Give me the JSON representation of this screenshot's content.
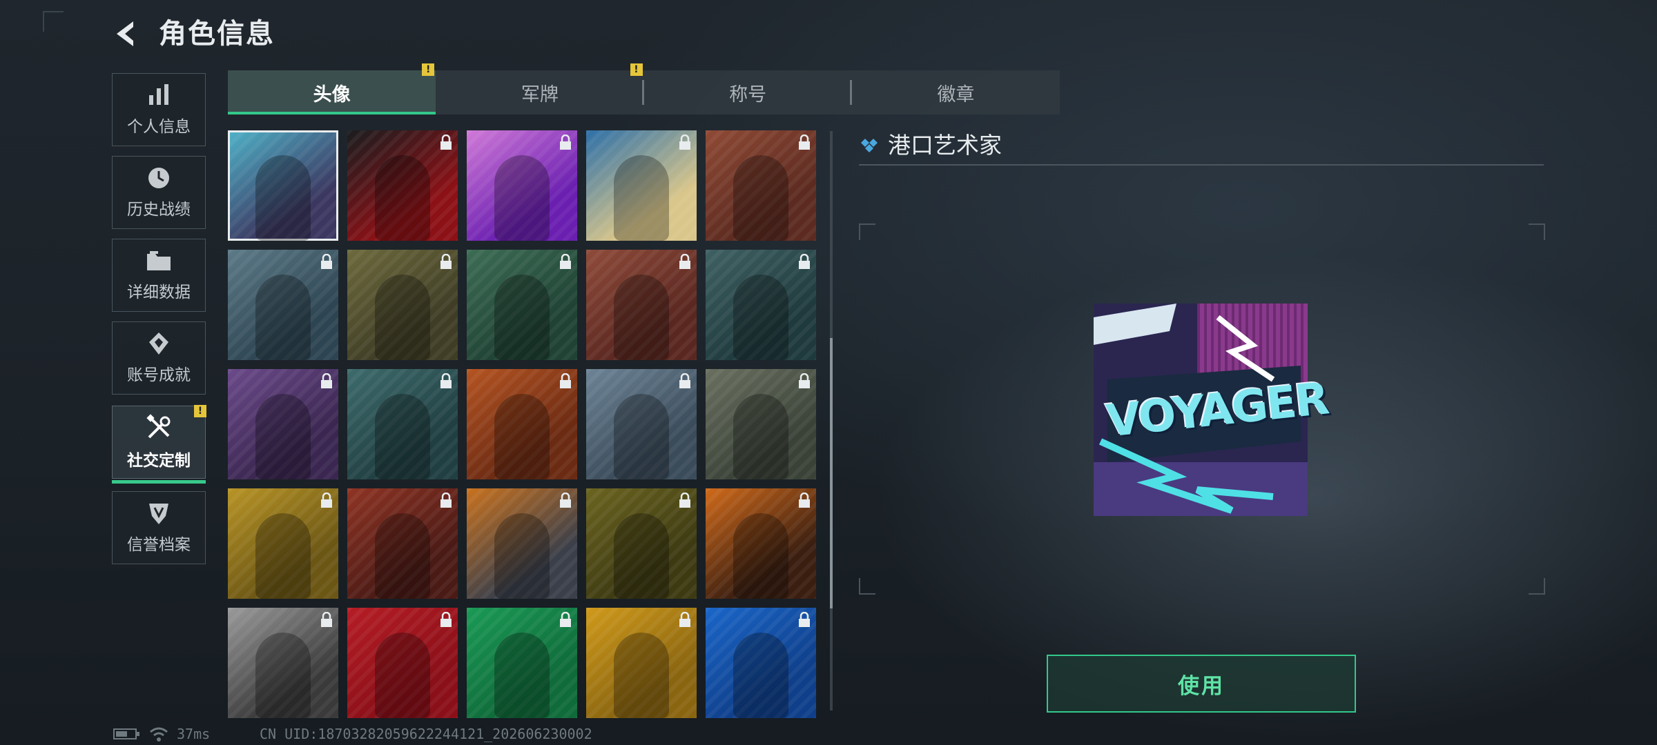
{
  "header": {
    "title": "角色信息"
  },
  "sidebar": {
    "items": [
      {
        "label": "个人信息",
        "icon": "bar-chart-icon"
      },
      {
        "label": "历史战绩",
        "icon": "clock-icon"
      },
      {
        "label": "详细数据",
        "icon": "folder-icon"
      },
      {
        "label": "账号成就",
        "icon": "achievement-icon"
      },
      {
        "label": "社交定制",
        "icon": "tools-icon",
        "active": true,
        "notice": "!"
      },
      {
        "label": "信誉档案",
        "icon": "credit-badge-icon"
      }
    ]
  },
  "tabs": [
    {
      "label": "头像",
      "active": true,
      "notice": "!"
    },
    {
      "label": "军牌",
      "notice": "!"
    },
    {
      "label": "称号"
    },
    {
      "label": "徽章"
    }
  ],
  "avatars": [
    {
      "name": "avatar-voyager-graffiti",
      "c1": "#3b3760",
      "c2": "#4fb3c9",
      "locked": false,
      "selected": true
    },
    {
      "name": "avatar-man-suit-sunglasses",
      "c1": "#8c1116",
      "c2": "#1a1d1f",
      "locked": true
    },
    {
      "name": "avatar-woman-goggles-purple",
      "c1": "#6a1fb0",
      "c2": "#d07ad8",
      "locked": true
    },
    {
      "name": "avatar-red-octopus-waves",
      "c1": "#d9c68a",
      "c2": "#2c6fa8",
      "locked": true
    },
    {
      "name": "avatar-bearded-man-cap",
      "c1": "#5c2a20",
      "c2": "#8f4a35",
      "locked": true
    },
    {
      "name": "avatar-woman-headset-blue",
      "c1": "#2d4552",
      "c2": "#5d7a88",
      "locked": true
    },
    {
      "name": "avatar-bald-bearded-man",
      "c1": "#3f3d25",
      "c2": "#6d6a3d",
      "locked": true
    },
    {
      "name": "avatar-man-headset-green",
      "c1": "#1f4234",
      "c2": "#3d6d55",
      "locked": true
    },
    {
      "name": "avatar-soldier-helmet-red",
      "c1": "#5a2720",
      "c2": "#8f4b3a",
      "locked": true
    },
    {
      "name": "avatar-man-glasses-teal",
      "c1": "#1f3a3d",
      "c2": "#3f6163",
      "locked": true
    },
    {
      "name": "avatar-woman-purple-hair",
      "c1": "#3a2650",
      "c2": "#6b4a8a",
      "locked": true
    },
    {
      "name": "avatar-masked-soldier-teal",
      "c1": "#203f42",
      "c2": "#3e6b6c",
      "locked": true
    },
    {
      "name": "avatar-hooded-man-orange",
      "c1": "#6b2a12",
      "c2": "#b55422",
      "locked": true
    },
    {
      "name": "avatar-star-emblem-blue",
      "c1": "#3a4b5a",
      "c2": "#6d8496",
      "locked": true
    },
    {
      "name": "avatar-helicopter-field",
      "c1": "#3a4238",
      "c2": "#6a7060",
      "locked": true
    },
    {
      "name": "avatar-dumpling-bowl-gold",
      "c1": "#6b5614",
      "c2": "#b89426",
      "locked": true
    },
    {
      "name": "avatar-red-hair-woman",
      "c1": "#4a1a15",
      "c2": "#8f3424",
      "locked": true
    },
    {
      "name": "avatar-eri-globe-logo",
      "c1": "#3a3f4a",
      "c2": "#c9721e",
      "locked": true
    },
    {
      "name": "avatar-man-glasses-olive",
      "c1": "#3d3a12",
      "c2": "#6b6420",
      "locked": true
    },
    {
      "name": "avatar-explosion-fire",
      "c1": "#3a1e10",
      "c2": "#d06a1a",
      "locked": true
    },
    {
      "name": "avatar-soldier-pistol-bw",
      "c1": "#3a3a3a",
      "c2": "#9a9a9a",
      "locked": true
    },
    {
      "name": "avatar-red-shield-logo",
      "c1": "#8a0f18",
      "c2": "#b61d25",
      "locked": true
    },
    {
      "name": "avatar-green-cross-logo",
      "c1": "#0f6b3a",
      "c2": "#1a9a55",
      "locked": true
    },
    {
      "name": "avatar-yellow-a-logo",
      "c1": "#8a6510",
      "c2": "#d09a1a",
      "locked": true
    },
    {
      "name": "avatar-blue-hexagon-logo",
      "c1": "#0f3f8a",
      "c2": "#1a66c9",
      "locked": true
    }
  ],
  "detail": {
    "title": "港口艺术家",
    "preview_text": "VOYAGER"
  },
  "use_button": "使用",
  "status": {
    "ping": "37ms",
    "uid": "CN UID:18703282059622244121_20260623000­2"
  },
  "colors": {
    "accent": "#34c88a",
    "notice": "#e5c53a"
  }
}
